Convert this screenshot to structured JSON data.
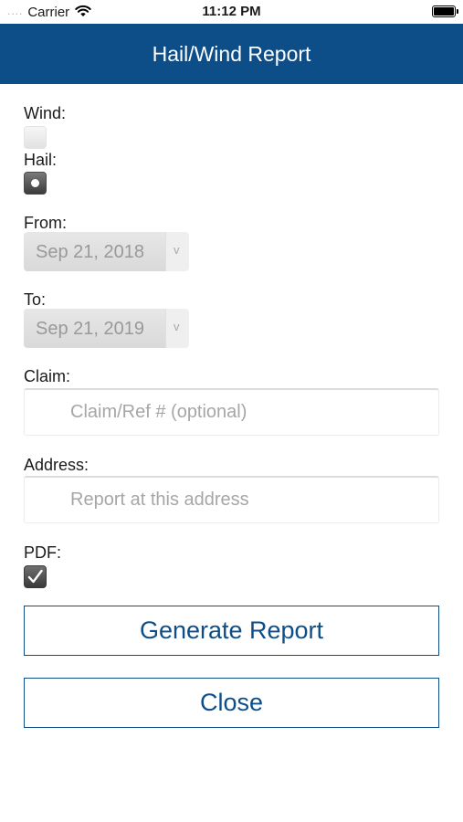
{
  "status_bar": {
    "carrier": "Carrier",
    "time": "11:12 PM",
    "signal_dots": "....",
    "wifi_icon": "wifi-icon",
    "battery_icon": "battery-icon"
  },
  "header": {
    "title": "Hail/Wind Report",
    "background": "#0d4e89"
  },
  "form": {
    "wind_label": "Wind:",
    "wind_checked": false,
    "hail_label": "Hail:",
    "hail_checked": true,
    "from_label": "From:",
    "from_value": "Sep 21, 2018",
    "to_label": "To:",
    "to_value": "Sep 21, 2019",
    "dropdown_arrow": "v",
    "claim_label": "Claim:",
    "claim_value": "",
    "claim_placeholder": "Claim/Ref # (optional)",
    "address_label": "Address:",
    "address_value": "",
    "address_placeholder": "Report at this address",
    "pdf_label": "PDF:",
    "pdf_checked": true
  },
  "buttons": {
    "generate_label": "Generate Report",
    "close_label": "Close"
  },
  "colors": {
    "accent": "#0d4e89",
    "placeholder": "#a6a6a6"
  }
}
